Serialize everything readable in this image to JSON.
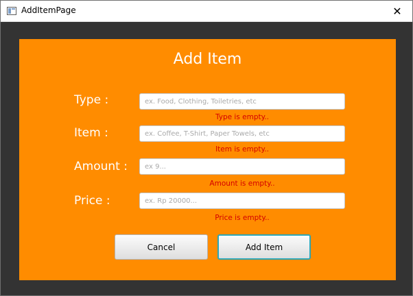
{
  "window": {
    "title": "AddItemPage",
    "close_glyph": "✕"
  },
  "form": {
    "heading": "Add Item",
    "rows": [
      {
        "label": "Type :",
        "placeholder": "ex. Food, Clothing, Toiletries, etc",
        "error": "Type is empty.."
      },
      {
        "label": "Item :",
        "placeholder": "ex. Coffee, T-Shirt, Paper Towels, etc",
        "error": "Item is empty.."
      },
      {
        "label": "Amount :",
        "placeholder": "ex 9...",
        "error": "Amount is empty.."
      },
      {
        "label": "Price :",
        "placeholder": "ex. Rp 20000...",
        "error": "Price is empty.."
      }
    ]
  },
  "buttons": {
    "cancel": "Cancel",
    "add": "Add Item"
  },
  "colors": {
    "panel": "#ff8c00",
    "backdrop": "#333333",
    "error": "#d40000",
    "focus": "#2aa7b8"
  },
  "icons": {
    "app": "window-app-icon",
    "close": "close-icon"
  }
}
